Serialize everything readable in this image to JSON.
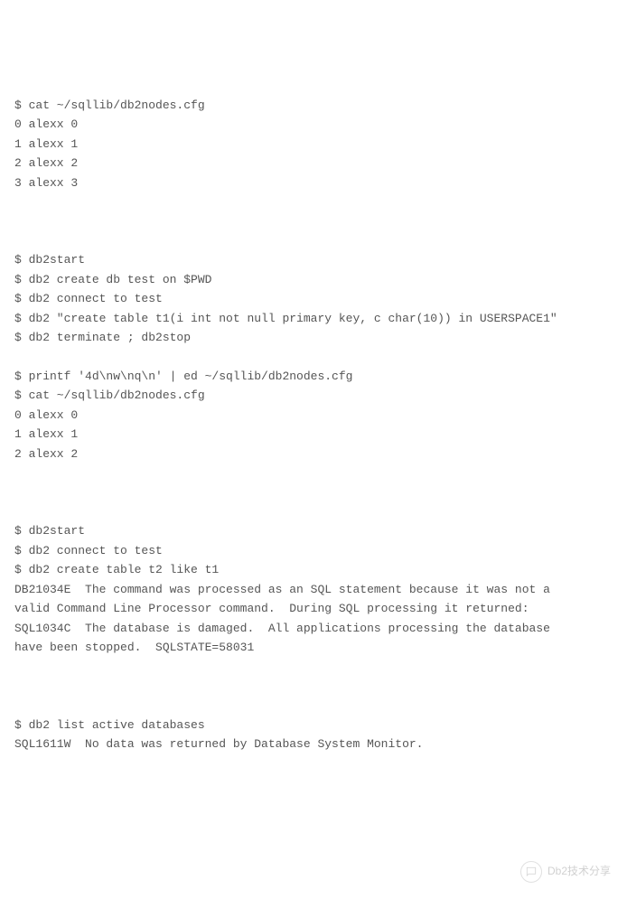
{
  "terminal": {
    "block1": "$ cat ~/sqllib/db2nodes.cfg\n0 alexx 0\n1 alexx 1\n2 alexx 2\n3 alexx 3",
    "block2": "$ db2start\n$ db2 create db test on $PWD\n$ db2 connect to test\n$ db2 \"create table t1(i int not null primary key, c char(10)) in USERSPACE1\"\n$ db2 terminate ; db2stop",
    "block3": "$ printf '4d\\nw\\nq\\n' | ed ~/sqllib/db2nodes.cfg\n$ cat ~/sqllib/db2nodes.cfg\n0 alexx 0\n1 alexx 1\n2 alexx 2",
    "block4": "$ db2start\n$ db2 connect to test\n$ db2 create table t2 like t1\nDB21034E  The command was processed as an SQL statement because it was not a\nvalid Command Line Processor command.  During SQL processing it returned:\nSQL1034C  The database is damaged.  All applications processing the database\nhave been stopped.  SQLSTATE=58031",
    "block5": "$ db2 list active databases\nSQL1611W  No data was returned by Database System Monitor."
  },
  "watermark": {
    "text": "Db2技术分享"
  }
}
